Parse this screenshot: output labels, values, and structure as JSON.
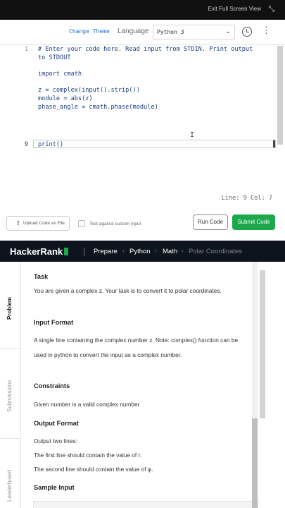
{
  "topbar": {
    "exit_fullscreen": "Exit Full Screen View"
  },
  "editor": {
    "change_theme": "Change Theme",
    "language_label": "Language",
    "language_value": "Python 3",
    "line_numbers": [
      "1",
      "",
      "",
      "",
      "",
      "",
      "",
      "",
      "9"
    ],
    "code_lines": [
      "# Enter your code here. Read input from STDIN. Print output",
      "to STDOUT",
      "",
      "import cmath",
      "",
      "z = complex(input().strip())",
      "module = abs(z)",
      "phase_angle = cmath.phase(module)",
      "",
      "print()"
    ],
    "status": "Line: 9 Col: 7",
    "upload_label": "Upload Code as File",
    "custom_input_label": "Test against custom input",
    "run_label": "Run Code",
    "submit_label": "Submit Code"
  },
  "nav": {
    "brand": "HackerRank",
    "breadcrumbs": [
      "Prepare",
      "Python",
      "Math",
      "Polar Coordinates"
    ]
  },
  "side_tabs": [
    "Problem",
    "Submissions",
    "Leaderboard"
  ],
  "problem": {
    "task_heading": "Task",
    "task_text": "You are given a complex z. Your task is to convert it to polar coordinates.",
    "input_heading": "Input Format",
    "input_text": "A single line containing the complex number z. Note: complex() function can be used in python to convert the input as a complex number.",
    "constraints_heading": "Constraints",
    "constraints_text": "Given number is a valid complex number",
    "output_heading": "Output Format",
    "output_line1": "Output two lines:",
    "output_line2": "The first line should contain the value of r.",
    "output_line3": "The second line should contain the value of φ.",
    "sample_heading": "Sample Input"
  }
}
